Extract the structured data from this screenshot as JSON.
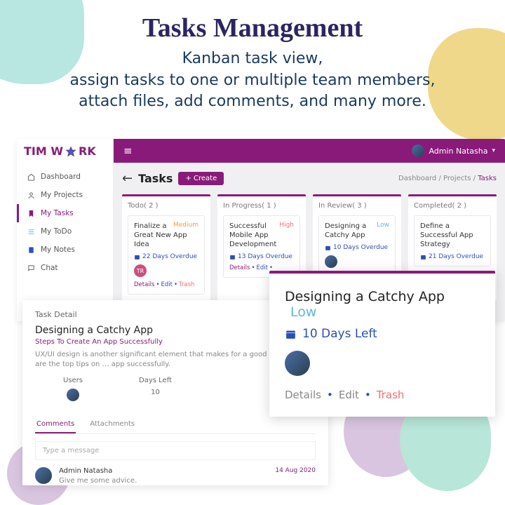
{
  "header": {
    "title": "Tasks Management",
    "line1": "Kanban task view,",
    "line2": "assign tasks to one or multiple team members,",
    "line3": "attach files, add comments, and many more."
  },
  "brand": {
    "p1": "TIM W",
    "p2": "RK"
  },
  "nav": [
    {
      "label": "Dashboard"
    },
    {
      "label": "My Projects"
    },
    {
      "label": "My Tasks"
    },
    {
      "label": "My ToDo"
    },
    {
      "label": "My Notes"
    },
    {
      "label": "Chat"
    }
  ],
  "topbar": {
    "user": "Admin Natasha"
  },
  "page": {
    "title": "Tasks",
    "create": "+ Create",
    "crumb": [
      "Dashboard",
      "Projects",
      "Tasks"
    ]
  },
  "cols": [
    {
      "name": "Todo( 2 )",
      "card": {
        "title": "Finalize a Great New App Idea",
        "prio": "Medium",
        "prioCls": "med",
        "due": "22 Days Overdue",
        "chip": "TR"
      }
    },
    {
      "name": "In Progress( 1 )",
      "card": {
        "title": "Successful Mobile App Development",
        "prio": "High",
        "prioCls": "high",
        "due": "13 Days Overdue",
        "chip": ""
      }
    },
    {
      "name": "In Review( 3 )",
      "card": {
        "title": "Designing a Catchy App",
        "prio": "Low",
        "prioCls": "low",
        "due": "10 Days Overdue",
        "chip": ""
      }
    },
    {
      "name": "Completed( 2 )",
      "card": {
        "title": "Define a Successful App Strategy",
        "prio": "",
        "prioCls": "high",
        "due": "21 Days Overdue",
        "chip": ""
      }
    }
  ],
  "cardActions": {
    "details": "Details",
    "edit": "Edit",
    "trash": "Trash"
  },
  "detail": {
    "label": "Task Detail",
    "title": "Designing a Catchy App",
    "subtitle": "Steps To Create An App Successfully",
    "desc": "UX/UI design is another significant element that makes for a good app. Here are the top tips on … app successfully.",
    "usersLbl": "Users",
    "daysLbl": "Days Left",
    "daysVal": "10",
    "tabs": [
      "Comments",
      "Attachments"
    ],
    "placeholder": "Type a message",
    "comment": {
      "author": "Admin Natasha",
      "text": "Give me some advice.",
      "date": "14 Aug 2020"
    }
  },
  "popup": {
    "title": "Designing a Catchy App",
    "prio": "Low",
    "due": "10 Days Left",
    "details": "Details",
    "edit": "Edit",
    "trash": "Trash"
  }
}
